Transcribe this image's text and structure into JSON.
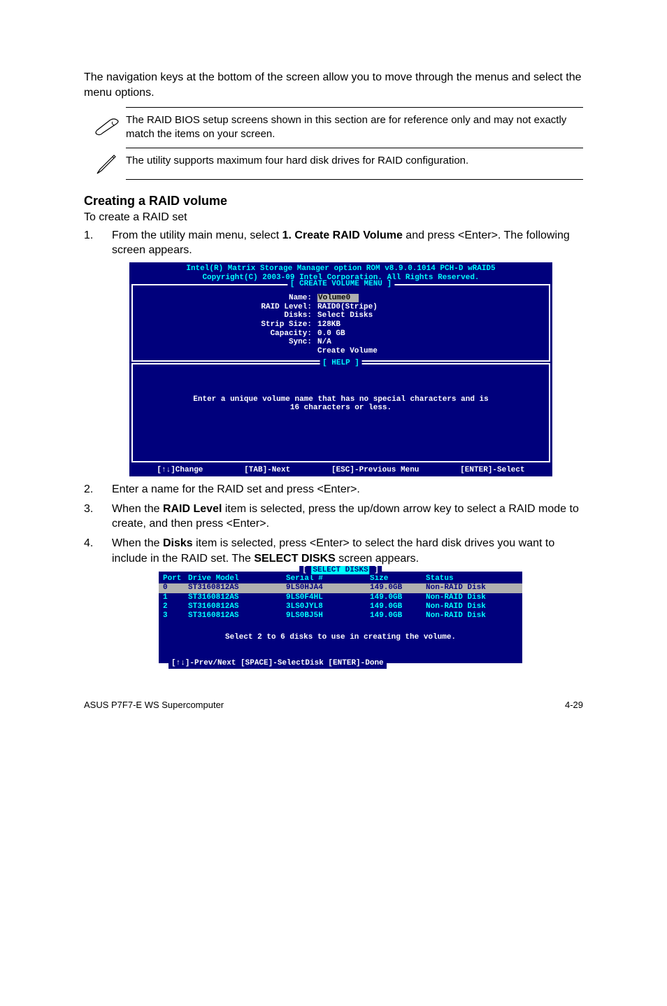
{
  "intro": "The navigation keys at the bottom of the screen allow you to move through the menus and select the menu options.",
  "notes": {
    "note1": "The RAID BIOS setup screens shown in this section are for reference only and may not exactly match the items on your screen.",
    "note2": "The utility supports maximum four hard disk drives for RAID configuration."
  },
  "heading": "Creating a RAID volume",
  "subtext": "To create a RAID set",
  "step1": {
    "num": "1.",
    "pre": "From the utility main menu, select ",
    "bold": "1. Create RAID Volume",
    "post": " and press <Enter>. The following screen appears."
  },
  "bios1": {
    "header_line1": "Intel(R) Matrix Storage Manager option ROM v8.9.0.1014 PCH-D wRAID5",
    "header_line2": "Copyright(C) 2003-09 Intel Corporation.  All Rights Reserved.",
    "box_title": "[ CREATE VOLUME MENU ]",
    "fields": {
      "name_label": "Name:",
      "name_value": "Volume0",
      "raid_label": "RAID Level:",
      "raid_value": "RAID0(Stripe)",
      "disks_label": "Disks:",
      "disks_value": "Select Disks",
      "strip_label": "Strip Size:",
      "strip_value": "128KB",
      "capacity_label": "Capacity:",
      "capacity_value": "0.0   GB",
      "sync_label": "Sync:",
      "sync_value": "N/A",
      "create_value": "Create Volume"
    },
    "help_title": "[ HELP ]",
    "help_line1": "Enter a unique volume name that has no special characters and is",
    "help_line2": "16 characters or less.",
    "footer": {
      "change": "[↑↓]Change",
      "tab": "[TAB]-Next",
      "esc": "[ESC]-Previous Menu",
      "enter": "[ENTER]-Select"
    }
  },
  "step2": {
    "num": "2.",
    "text": "Enter a name for the RAID set and press <Enter>."
  },
  "step3": {
    "num": "3.",
    "pre": "When the ",
    "bold": "RAID Level",
    "post": " item is selected, press the up/down arrow key to select a RAID mode to create, and then press <Enter>."
  },
  "step4": {
    "num": "4.",
    "pre": "When the ",
    "bold": "Disks",
    "post1": " item is selected, press <Enter> to select the hard disk drives you want to include in the RAID set. The ",
    "bold2": "SELECT DISKS",
    "post2": " screen appears."
  },
  "bios2": {
    "title": "SELECT DISKS",
    "header": {
      "port": "Port",
      "model": "Drive Model",
      "serial": "Serial #",
      "size": "Size",
      "status": "Status"
    },
    "rows": [
      {
        "port": "0",
        "model": "ST3160812AS",
        "serial": "9LS0HJA4",
        "size": "149.0GB",
        "status": "Non-RAID Disk",
        "selected": true
      },
      {
        "port": "1",
        "model": "ST3160812AS",
        "serial": "9LS0F4HL",
        "size": "149.0GB",
        "status": "Non-RAID Disk",
        "selected": false
      },
      {
        "port": "2",
        "model": "ST3160812AS",
        "serial": "3LS0JYL8",
        "size": "149.0GB",
        "status": "Non-RAID Disk",
        "selected": false
      },
      {
        "port": "3",
        "model": "ST3160812AS",
        "serial": "9LS0BJ5H",
        "size": "149.0GB",
        "status": "Non-RAID Disk",
        "selected": false
      }
    ],
    "instr": "Select 2 to 6 disks to use in creating the volume.",
    "footer": "[↑↓]-Prev/Next [SPACE]-SelectDisk [ENTER]-Done"
  },
  "pageFooter": {
    "left": "ASUS P7F7-E WS Supercomputer",
    "right": "4-29"
  }
}
